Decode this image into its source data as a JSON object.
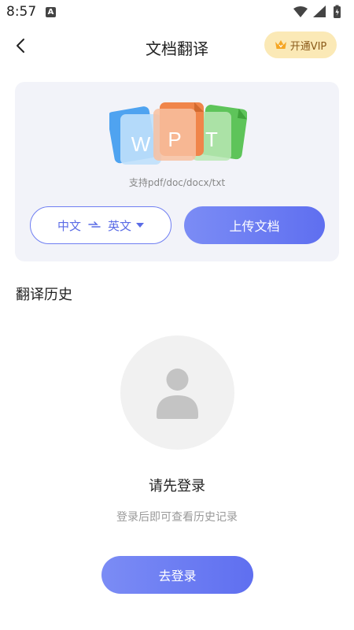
{
  "status_bar": {
    "time": "8:57",
    "notification_icon": "a-icon",
    "icons": [
      "wifi-icon",
      "signal-icon",
      "battery-icon"
    ]
  },
  "header": {
    "title": "文档翻译",
    "back_icon": "chevron-left-icon",
    "vip": {
      "label": "开通VIP",
      "icon": "crown-icon",
      "bg_color": "#fbe9b6",
      "text_color": "#8a5a1a"
    }
  },
  "upload_card": {
    "doc_letters": [
      "W",
      "P",
      "T"
    ],
    "support_text": "支持pdf/doc/docx/txt",
    "language": {
      "source": "中文",
      "target": "英文"
    },
    "upload_label": "上传文档",
    "accent_color": "#6374f0"
  },
  "history": {
    "title": "翻译历史",
    "empty": {
      "avatar_icon": "user-icon",
      "prompt": "请先登录",
      "subtext": "登录后即可查看历史记录",
      "login_label": "去登录"
    }
  }
}
